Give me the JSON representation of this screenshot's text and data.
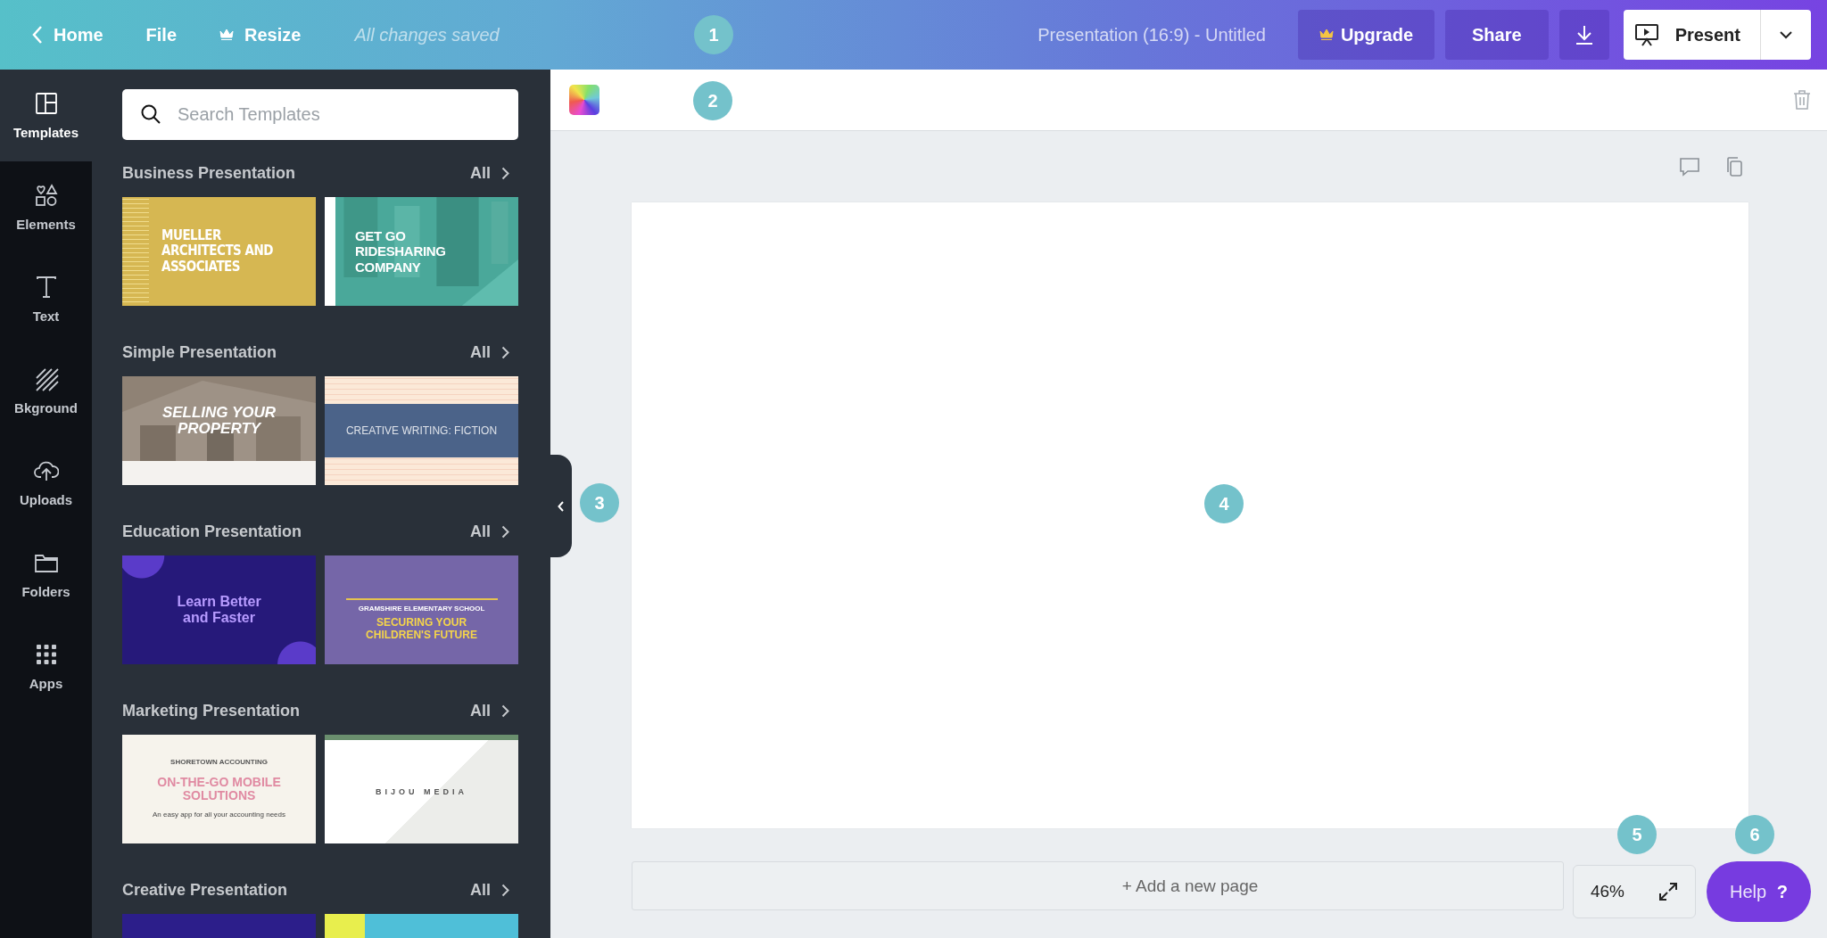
{
  "topbar": {
    "back": "Home",
    "menu": [
      "File"
    ],
    "resize": "Resize",
    "save_status": "All changes saved",
    "title": "Presentation (16:9) - Untitled",
    "upgrade": "Upgrade",
    "share": "Share",
    "present": "Present"
  },
  "rail": [
    {
      "label": "Templates",
      "kind": "templates",
      "selected": true
    },
    {
      "label": "Elements",
      "kind": "elements",
      "selected": false
    },
    {
      "label": "Text",
      "kind": "text",
      "selected": false
    },
    {
      "label": "Bkground",
      "kind": "background",
      "selected": false
    },
    {
      "label": "Uploads",
      "kind": "uploads",
      "selected": false
    },
    {
      "label": "Folders",
      "kind": "folders",
      "selected": false
    },
    {
      "label": "Apps",
      "kind": "apps",
      "selected": false
    }
  ],
  "panel": {
    "search": {
      "placeholder": "Search Templates"
    },
    "sections": [
      {
        "title": "Business Presentation",
        "link": "All",
        "templates": [
          {
            "kind": "gold-grid",
            "texts": [
              "MUELLER ARCHITECTS AND ASSOCIATES"
            ]
          },
          {
            "kind": "teal-photo",
            "texts": [
              "GET GO RIDESHARING COMPANY"
            ]
          }
        ]
      },
      {
        "title": "Simple Presentation",
        "link": "All",
        "templates": [
          {
            "kind": "brown-photo",
            "texts": [
              "SELLING YOUR PROPERTY"
            ]
          },
          {
            "kind": "striped-band",
            "texts": [
              "CREATIVE WRITING: FICTION"
            ]
          }
        ]
      },
      {
        "title": "Education Presentation",
        "link": "All",
        "templates": [
          {
            "kind": "indigo-blobs",
            "texts": [
              "Learn Better and Faster"
            ]
          },
          {
            "kind": "violet-icons",
            "texts": [
              "GRAMSHIRE ELEMENTARY SCHOOL",
              "SECURING YOUR CHILDREN'S FUTURE"
            ]
          }
        ]
      },
      {
        "title": "Marketing Presentation",
        "link": "All",
        "templates": [
          {
            "kind": "cream-lines",
            "texts": [
              "SHORETOWN ACCOUNTING",
              "ON-THE-GO MOBILE SOLUTIONS",
              "An easy app for all your accounting needs"
            ]
          },
          {
            "kind": "green-diagonal",
            "texts": [
              "BIJOU MEDIA"
            ]
          }
        ]
      },
      {
        "title": "Creative Presentation",
        "link": "All",
        "templates": [
          {
            "kind": "indigo-stars"
          },
          {
            "kind": "yellow-pattern"
          }
        ]
      }
    ]
  },
  "canvas": {
    "add_page": "+ Add a new page",
    "zoom": "46%",
    "help": "Help",
    "help_icon": "?"
  },
  "callouts": [
    "1",
    "2",
    "3",
    "4",
    "5",
    "6"
  ]
}
